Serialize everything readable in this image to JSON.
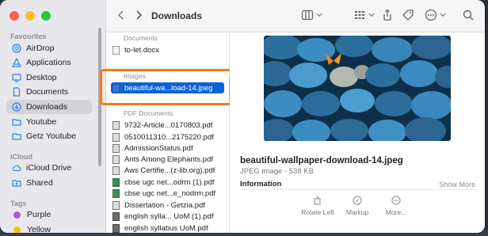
{
  "window": {
    "title": "Downloads"
  },
  "sidebar": {
    "favourites_label": "Favourites",
    "favourites": [
      {
        "label": "AirDrop",
        "icon": "airdrop-icon"
      },
      {
        "label": "Applications",
        "icon": "applications-icon"
      },
      {
        "label": "Desktop",
        "icon": "desktop-icon"
      },
      {
        "label": "Documents",
        "icon": "document-icon"
      },
      {
        "label": "Downloads",
        "icon": "download-icon",
        "selected": true
      },
      {
        "label": "Youtube",
        "icon": "folder-icon"
      },
      {
        "label": "Getz Youtube",
        "icon": "folder-icon"
      }
    ],
    "icloud_label": "iCloud",
    "icloud": [
      {
        "label": "iCloud Drive",
        "icon": "cloud-icon"
      },
      {
        "label": "Shared",
        "icon": "shared-folder-icon"
      }
    ],
    "tags_label": "Tags",
    "tags": [
      {
        "label": "Purple",
        "color": "#a45ad0"
      },
      {
        "label": "Yellow",
        "color": "#f2c500"
      }
    ]
  },
  "file_list": {
    "groups": [
      {
        "label": "Documents",
        "files": [
          {
            "name": "to-let.docx",
            "icon": "doc"
          }
        ]
      },
      {
        "label": "Images",
        "files": [
          {
            "name": "beautiful-wa...load-14.jpeg",
            "icon": "img",
            "selected": true
          }
        ]
      },
      {
        "label": "PDF Documents",
        "files": [
          {
            "name": "9732-Article...0170803.pdf",
            "icon": "pdf"
          },
          {
            "name": "0510011310...2175220.pdf",
            "icon": "pdf"
          },
          {
            "name": "AdmissionStatus.pdf",
            "icon": "pdf"
          },
          {
            "name": "Ants Among Elephants.pdf",
            "icon": "pdf"
          },
          {
            "name": "Aws Certifie...(z-lib.org).pdf",
            "icon": "pdf"
          },
          {
            "name": "cbse ugc net...odrm (1).pdf",
            "icon": "book"
          },
          {
            "name": "cbse ugc net...e_nodrm.pdf",
            "icon": "book"
          },
          {
            "name": "Dissertation - Getzia.pdf",
            "icon": "pdf"
          },
          {
            "name": "english sylla... UoM (1).pdf",
            "icon": "scan"
          },
          {
            "name": "english syllabus UoM.pdf",
            "icon": "scan"
          }
        ]
      }
    ]
  },
  "preview": {
    "file_name": "beautiful-wallpaper-download-14.jpeg",
    "kind": "JPEG image - 538 KB",
    "info_label": "Information",
    "show_more": "Show More",
    "actions": [
      {
        "label": "Rotate Left",
        "icon": "rotate-left-icon"
      },
      {
        "label": "Markup",
        "icon": "markup-icon"
      },
      {
        "label": "More...",
        "icon": "more-icon"
      }
    ]
  },
  "colors": {
    "accent": "#0a63d8",
    "highlight_box": "#ef7d1a"
  }
}
